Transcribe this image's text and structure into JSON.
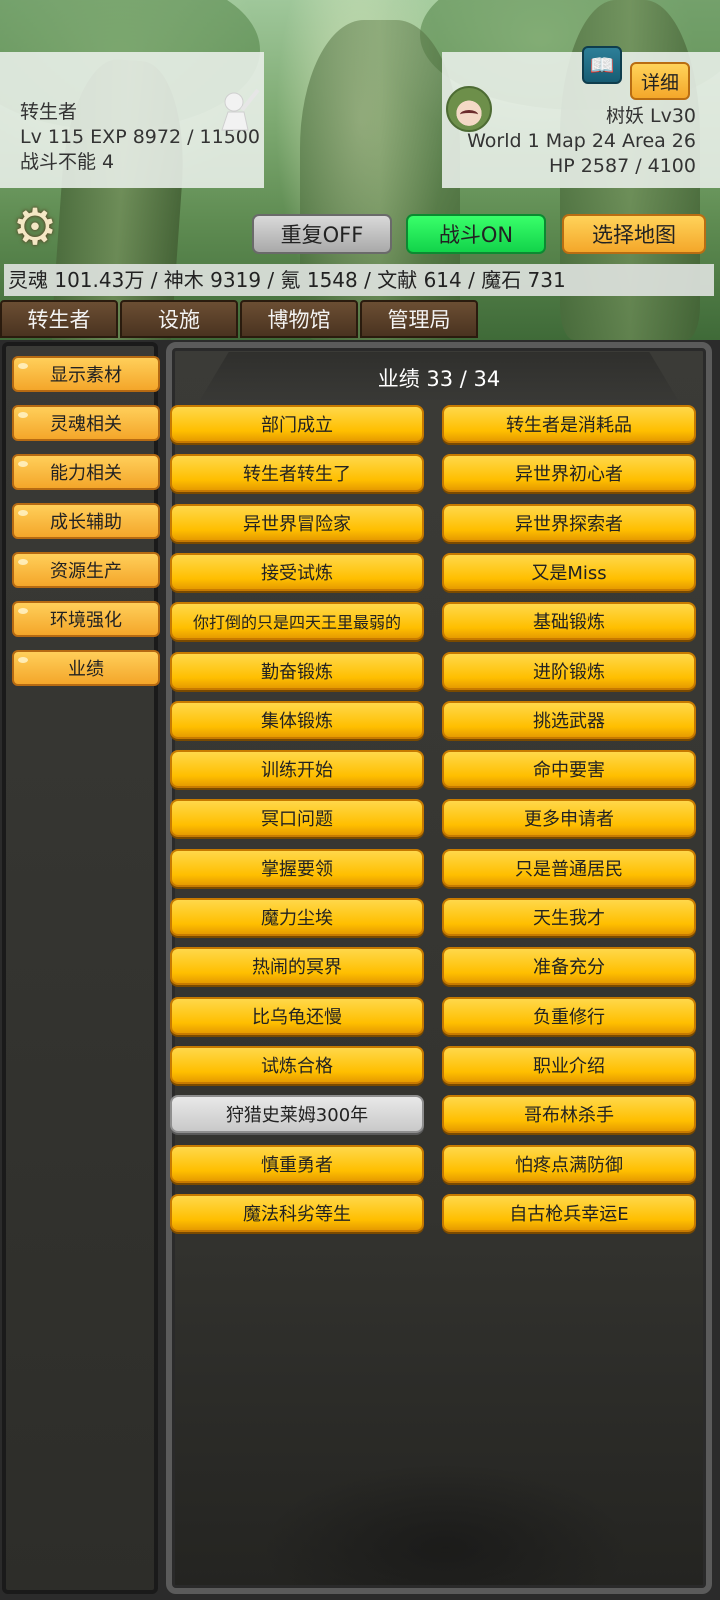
{
  "player": {
    "name": "转生者",
    "stats": "Lv 115 EXP 8972 / 11500",
    "status": "战斗不能 4"
  },
  "enemy": {
    "name": "树妖 Lv30",
    "location": "World 1 Map 24 Area 26",
    "hp": "HP 2587 / 4100",
    "detail_label": "详细",
    "book_icon": "book-icon"
  },
  "toolbar": {
    "repeat_label": "重复OFF",
    "battle_label": "战斗ON",
    "map_label": "选择地图"
  },
  "resources": "灵魂 101.43万 / 神木 9319 / 氪 1548 / 文献 614 / 魔石 731",
  "main_tabs": [
    "转生者",
    "设施",
    "博物馆",
    "管理局"
  ],
  "sidebar": [
    "显示素材",
    "灵魂相关",
    "能力相关",
    "成长辅助",
    "资源生产",
    "环境强化",
    "业绩"
  ],
  "achievements": {
    "title": "业绩 33 / 34",
    "items": [
      "部门成立",
      "转生者是消耗品",
      "转生者转生了",
      "异世界初心者",
      "异世界冒险家",
      "异世界探索者",
      "接受试炼",
      "又是Miss",
      "你打倒的只是四天王里最弱的",
      "基础锻炼",
      "勤奋锻炼",
      "进阶锻炼",
      "集体锻炼",
      "挑选武器",
      "训练开始",
      "命中要害",
      "冥口问题",
      "更多申请者",
      "掌握要领",
      "只是普通居民",
      "魔力尘埃",
      "天生我才",
      "热闹的冥界",
      "准备充分",
      "比乌龟还慢",
      "负重修行",
      "试炼合格",
      "职业介绍",
      "狩猎史莱姆300年",
      "哥布林杀手",
      "慎重勇者",
      "怕疼点满防御",
      "魔法科劣等生",
      "自古枪兵幸运E"
    ],
    "locked": [
      "狩猎史莱姆300年"
    ]
  }
}
